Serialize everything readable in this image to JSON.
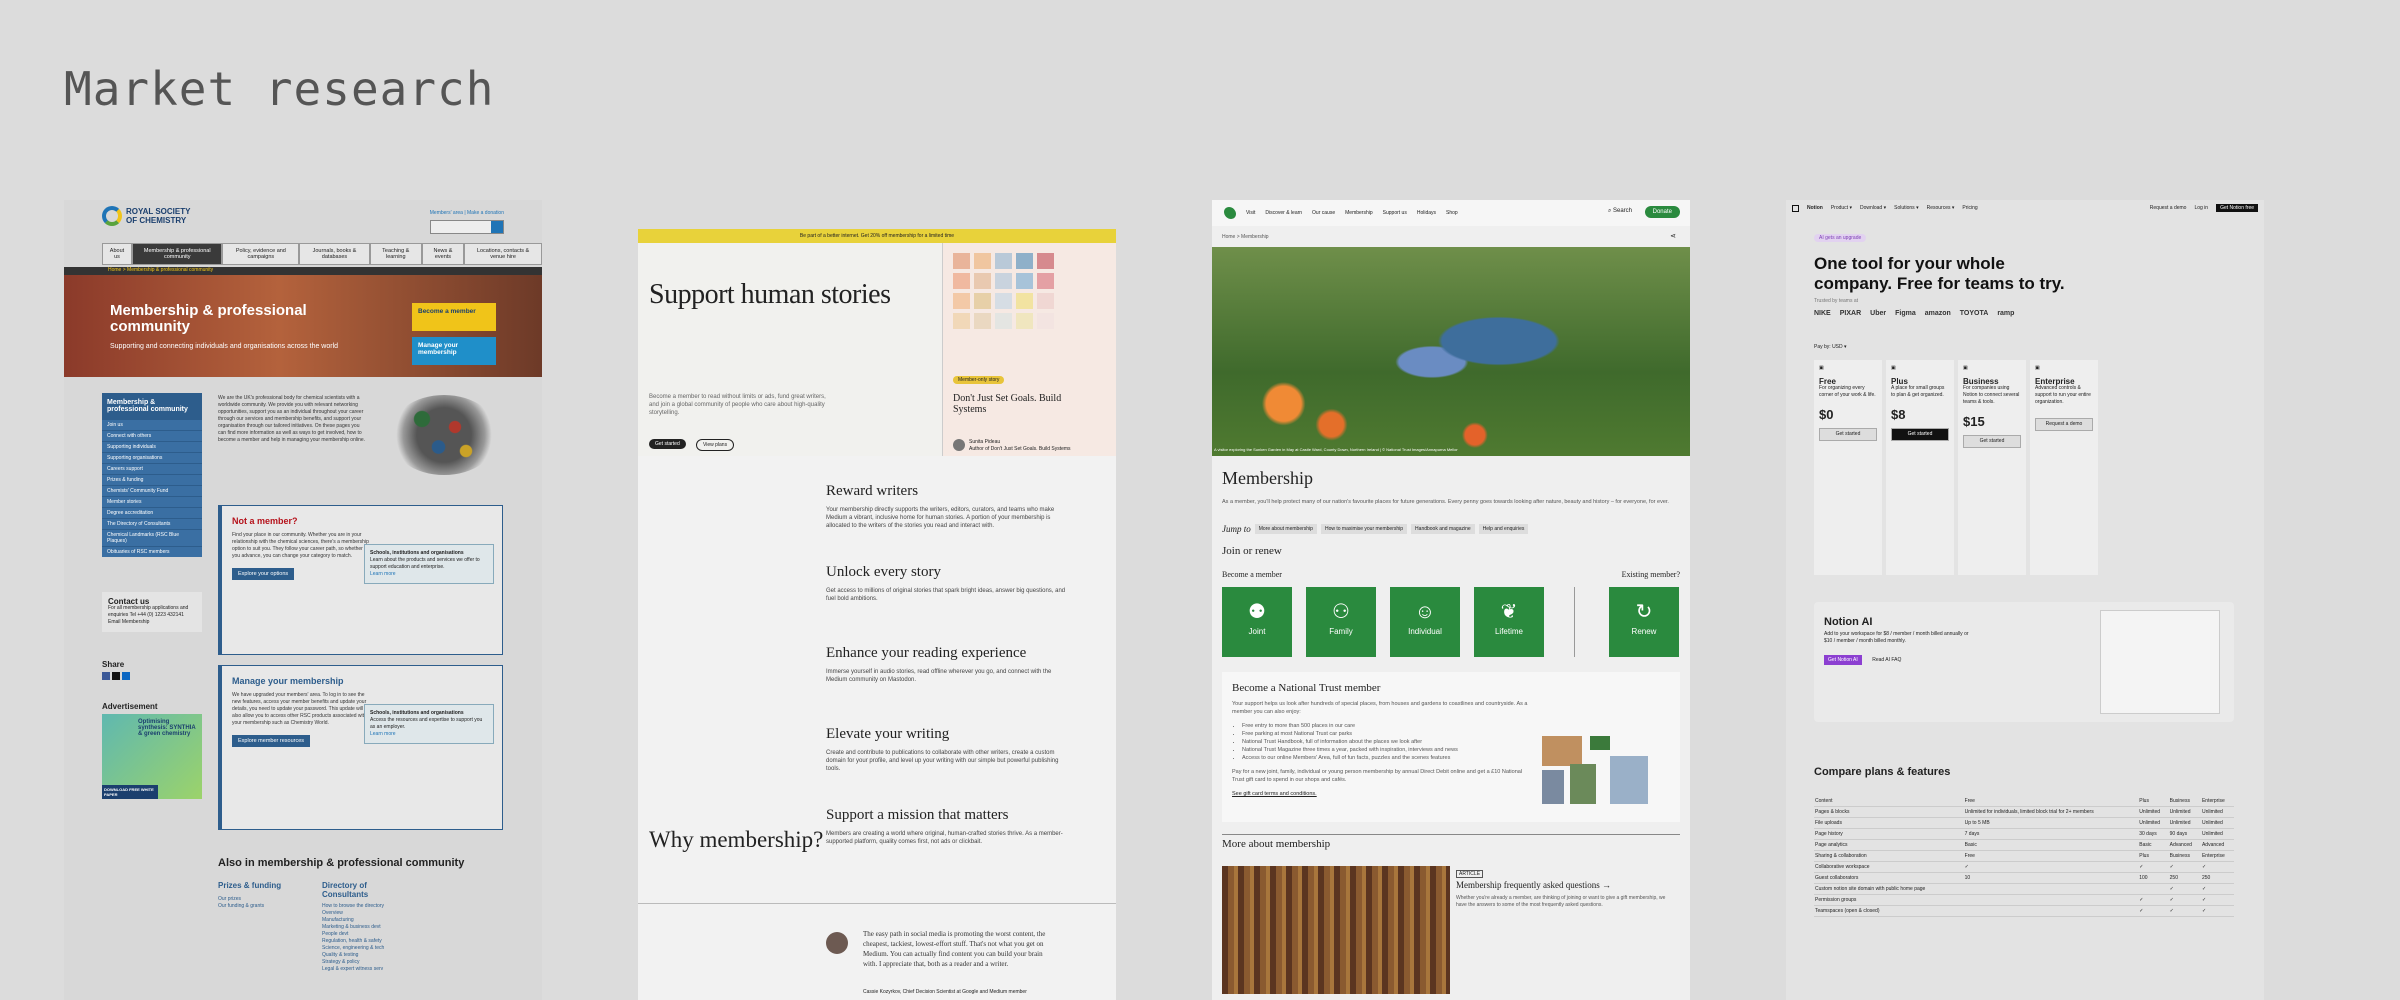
{
  "board_title": "Market research",
  "rsc": {
    "logo": [
      "ROYAL SOCIETY",
      "OF CHEMISTRY"
    ],
    "toplinks": "Members' area  |  Make a donation",
    "nav": [
      "About us",
      "Membership & professional community",
      "Policy, evidence and campaigns",
      "Journals, books & databases",
      "Teaching & learning",
      "News & events",
      "Locations, contacts & venue hire"
    ],
    "crumb": "Home  >  Membership & professional community",
    "hero_title": "Membership & professional community",
    "hero_sub": "Supporting and connecting individuals and organisations across the world",
    "cta_become": "Become a member",
    "cta_manage": "Manage your membership",
    "side_title": "Membership & professional community",
    "side_items": [
      "Join us",
      "Connect with others",
      "Supporting individuals",
      "Supporting organisations",
      "Careers support",
      "Prizes & funding",
      "Chemists' Community Fund",
      "Member stories",
      "Degree accreditation",
      "The Directory of Consultants",
      "Chemical Landmarks (RSC Blue Plaques)",
      "Obituaries of RSC members"
    ],
    "intro": "We are the UK's professional body for chemical scientists with a worldwide community. We provide you with relevant networking opportunities, support you as an individual throughout your career through our services and membership benefits, and support your organisation through our tailored initiatives. On these pages you can find more information as well as ways to get involved, how to become a member and help in managing your membership online.",
    "not_member": "Not a member?",
    "not_member_p": "Find your place in our community. Whether you are in your relationship with the chemical sciences, there's a membership option to suit you. They follow your career path, so whether you advance, you can change your category to match.",
    "inner_title": "Schools, institutions and organisations",
    "inner_p": "Learn about the products and services we offer to support education and enterprise.",
    "learn_more": "Learn more",
    "explore_options": "Explore your options",
    "manage_title": "Manage your membership",
    "manage_p": "We have upgraded your members' area. To log in to see the new features, access your member benefits and update your details, you need to update your password. This update will also allow you to access other RSC products associated with your membership such as Chemistry World.",
    "inner2_p": "Access the resources and expertise to support you as an employer.",
    "explore_resources": "Explore member resources",
    "contact_title": "Contact us",
    "contact_p": "For all membership applications and enquiries Tel +44 (0) 1223 432141 Email Membership",
    "share": "Share",
    "advert": "Advertisement",
    "ad_text": "Optimising synthesis: SYNTHIA & green chemistry",
    "ad_cta": "DOWNLOAD FREE WHITE PAPER",
    "also": "Also in membership & professional community",
    "prizes": "Prizes & funding",
    "prizes_items": [
      "Our prizes",
      "Our funding & grants"
    ],
    "directory": "Directory of Consultants",
    "directory_items": [
      "How to browse the directory",
      "Overview",
      "Manufacturing",
      "Marketing & business devt",
      "People devt",
      "Regulation, health & safety",
      "Science, engineering & tech",
      "Quality & testing",
      "Strategy & policy",
      "Legal & expert witness serv"
    ]
  },
  "medium": {
    "banner": "Be part of a better internet. Get 20% off membership for a limited time",
    "hero_title": "Support human stories",
    "hero_p": "Become a member to read without limits or ads, fund great writers, and join a global community of people who care about high-quality storytelling.",
    "btn_start": "Get started",
    "btn_plans": "View plans",
    "badge": "Member-only story",
    "book_title": "Don't Just Set Goals. Build Systems",
    "author": "Sunita Pideau",
    "author_sub": "Author of Don't Just Set Goals. Build Systems",
    "swatch_colors": [
      "#e9b49a",
      "#f0c6a0",
      "#b9c9d8",
      "#8fb0c9",
      "#d68a8e",
      "#f0b9a0",
      "#e9c9b0",
      "#c9d3de",
      "#a7c3d9",
      "#e4a0a4",
      "#f3c9a7",
      "#e7d0a8",
      "#d6dde4",
      "#f2e3a1",
      "#f0d7d3",
      "#f1d8b8",
      "#ead8c1",
      "#e4e5e2",
      "#f0e6bf",
      "#f3e4e1"
    ],
    "items": [
      {
        "t": "Reward writers",
        "d": "Your membership directly supports the writers, editors, curators, and teams who make Medium a vibrant, inclusive home for human stories. A portion of your membership is allocated to the writers of the stories you read and interact with."
      },
      {
        "t": "Unlock every story",
        "d": "Get access to millions of original stories that spark bright ideas, answer big questions, and fuel bold ambitions."
      },
      {
        "t": "Enhance your reading experience",
        "d": "Immerse yourself in audio stories, read offline wherever you go, and connect with the Medium community on Mastodon."
      },
      {
        "t": "Elevate your writing",
        "d": "Create and contribute to publications to collaborate with other writers, create a custom domain for your profile, and level up your writing with our simple but powerful publishing tools."
      },
      {
        "t": "Support a mission that matters",
        "d": "Members are creating a world where original, human-crafted stories thrive. As a member-supported platform, quality comes first, not ads or clickbait."
      }
    ],
    "why": "Why membership?",
    "quote": "The easy path in social media is promoting the worst content, the cheapest, tackiest, lowest-effort stuff. That's not what you get on Medium. You can actually find content you can build your brain with. I appreciate that, both as a reader and a writer.",
    "cite": "Cassie Kozyrkov, Chief Decision Scientist at Google and Medium member"
  },
  "nt": {
    "nav": [
      "Visit",
      "Discover & learn",
      "Our cause",
      "Membership",
      "Support us",
      "Holidays",
      "Shop"
    ],
    "search": "Search",
    "donate": "Donate",
    "crumbs": "Home  >  Membership",
    "caption": "A visitor exploring the Sunken Garden in May at Castle Ward, County Down, Northern Ireland | © National Trust Images/Annapurna Mellor",
    "title": "Membership",
    "intro": "As a member, you'll help protect many of our nation's favourite places for future generations. Every penny goes towards looking after nature, beauty and history – for everyone, for ever.",
    "jump": "Jump to",
    "chips": [
      "More about membership",
      "How to maximise your membership",
      "Handbook and magazine",
      "Help and enquiries"
    ],
    "join": "Join or renew",
    "become": "Become a member",
    "existing": "Existing member?",
    "tiles": [
      {
        "icon": "⚉",
        "label": "Joint"
      },
      {
        "icon": "⚇",
        "label": "Family"
      },
      {
        "icon": "☺",
        "label": "Individual"
      },
      {
        "icon": "❦",
        "label": "Lifetime"
      }
    ],
    "renew": {
      "icon": "↻",
      "label": "Renew"
    },
    "card_title": "Become a National Trust member",
    "card_p": "Your support helps us look after hundreds of special places, from houses and gardens to coastlines and countryside. As a member you can also enjoy:",
    "benefits": [
      "Free entry to more than 500 places in our care",
      "Free parking at most National Trust car parks",
      "National Trust Handbook, full of information about the places we look after",
      "National Trust Magazine three times a year, packed with inspiration, interviews and news",
      "Access to our online Members' Area, full of fun facts, puzzles and the scenes features"
    ],
    "card_p2": "Pay for a new joint, family, individual or young person membership by annual Direct Debit online and get a £10 National Trust gift card to spend in our shops and cafés.",
    "card_link": "See gift card terms and conditions.",
    "more": "More about membership",
    "faq_tag": "ARTICLE",
    "faq_title": "Membership frequently asked questions →",
    "faq_p": "Whether you're already a member, are thinking of joining or want to give a gift membership, we have the answers to some of the most frequently asked questions."
  },
  "notion": {
    "brand": "Notion",
    "nav": [
      "Product ▾",
      "Download ▾",
      "Solutions ▾",
      "Resources ▾",
      "Pricing"
    ],
    "right": [
      "Request a demo",
      "Log in",
      "Get Notion free"
    ],
    "pill": "AI gets an upgrade",
    "title": "One tool for your whole company. Free for teams to try.",
    "trusted": "Trusted by teams at",
    "logos": [
      "NIKE",
      "PIXAR",
      "Uber",
      "Figma",
      "amazon",
      "TOYOTA",
      "ramp"
    ],
    "billing": "Pay by: USD ▾",
    "plans": [
      {
        "name": "Free",
        "price": "$0",
        "cta": "Get started",
        "desc": "For organizing every corner of your work & life."
      },
      {
        "name": "Plus",
        "price": "$8",
        "cta": "Get started",
        "desc": "A place for small groups to plan & get organized."
      },
      {
        "name": "Business",
        "price": "$15",
        "cta": "Get started",
        "desc": "For companies using Notion to connect several teams & tools."
      },
      {
        "name": "Enterprise",
        "price": "",
        "cta": "Request a demo",
        "desc": "Advanced controls & support to run your entire organization."
      }
    ],
    "ai_title": "Notion AI",
    "ai_p": "Add to your workspace for $8 / member / month billed annually or $10 / member / month billed monthly.",
    "ai_btn": "Get Notion AI",
    "ai_link": "Read AI FAQ",
    "compare": "Compare plans & features",
    "table_head": [
      "Content",
      "Free",
      "Plus",
      "Business",
      "Enterprise"
    ],
    "table_rows": [
      [
        "Pages & blocks",
        "Unlimited for individuals, limited block trial for 2+ members",
        "Unlimited",
        "Unlimited",
        "Unlimited"
      ],
      [
        "File uploads",
        "Up to 5 MB",
        "Unlimited",
        "Unlimited",
        "Unlimited"
      ],
      [
        "Page history",
        "7 days",
        "30 days",
        "90 days",
        "Unlimited"
      ],
      [
        "Page analytics",
        "Basic",
        "Basic",
        "Advanced",
        "Advanced"
      ],
      [
        "Sharing & collaboration",
        "Free",
        "Plus",
        "Business",
        "Enterprise"
      ],
      [
        "Collaborative workspace",
        "✓",
        "✓",
        "✓",
        "✓"
      ],
      [
        "Guest collaborators",
        "10",
        "100",
        "250",
        "250"
      ],
      [
        "Custom notion site domain with public home page",
        "",
        "",
        "✓",
        "✓"
      ],
      [
        "Permission groups",
        "",
        "✓",
        "✓",
        "✓"
      ],
      [
        "Teamspaces (open & closed)",
        "",
        "✓",
        "✓",
        "✓"
      ]
    ]
  }
}
